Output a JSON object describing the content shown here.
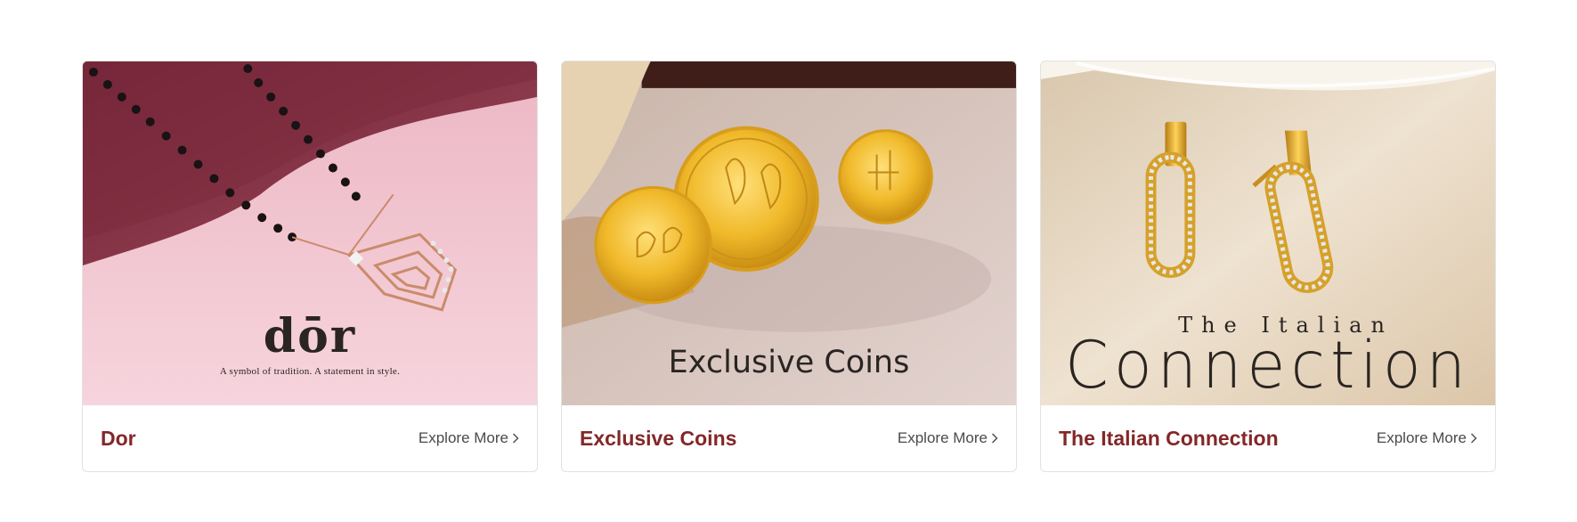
{
  "cards": [
    {
      "title": "Dor",
      "explore_label": "Explore More",
      "image": {
        "logo_text": "dōr",
        "tagline": "A symbol of tradition. A statement in style.",
        "background": "#f3c6d2"
      }
    },
    {
      "title": "Exclusive Coins",
      "explore_label": "Explore More",
      "image": {
        "caption": "Exclusive Coins",
        "background": "#d6c4c0"
      }
    },
    {
      "title": "The Italian Connection",
      "explore_label": "Explore More",
      "image": {
        "small_text": "The Italian",
        "big_text": "Connection",
        "background": "#e6d6bf"
      }
    }
  ],
  "colors": {
    "title": "#832729",
    "explore": "#4a4a4a",
    "border": "#e2e2e2"
  },
  "icons": [
    "chevron-right-icon"
  ]
}
